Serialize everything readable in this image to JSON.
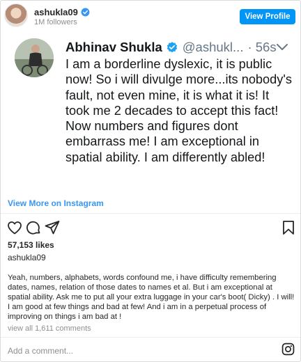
{
  "header": {
    "username": "ashukla09",
    "followers": "1M followers",
    "view_profile": "View Profile"
  },
  "tweet": {
    "name": "Abhinav Shukla",
    "handle": "@ashukl...",
    "time": "· 56s",
    "text": "I am a borderline dyslexic, it is public now! So i will divulge more...its nobody's fault, not even mine, it is what it is! It took me 2 decades to accept this fact! Now numbers and figures dont embarrass me! I am exceptional in spatial ability. I am differently abled!"
  },
  "view_more": "View More on Instagram",
  "post": {
    "likes": "57,153 likes",
    "owner": "ashukla09",
    "caption": "Yeah, numbers, alphabets, words confound me, i have difficulty remembering dates, names, relation of those dates to names et al. But i am exceptional at spatial ability. Ask me to put all your extra luggage in your car's boot( Dicky) . I will! I am good at few things and bad at few! And i am in a perpetual process of improving on things i am bad at !",
    "comments_link": "view all 1,611 comments",
    "add_comment_placeholder": "Add a comment..."
  },
  "icons": {
    "verified_color": "#3897f0",
    "link_color": "#3897f0",
    "button_color": "#0095f6"
  }
}
